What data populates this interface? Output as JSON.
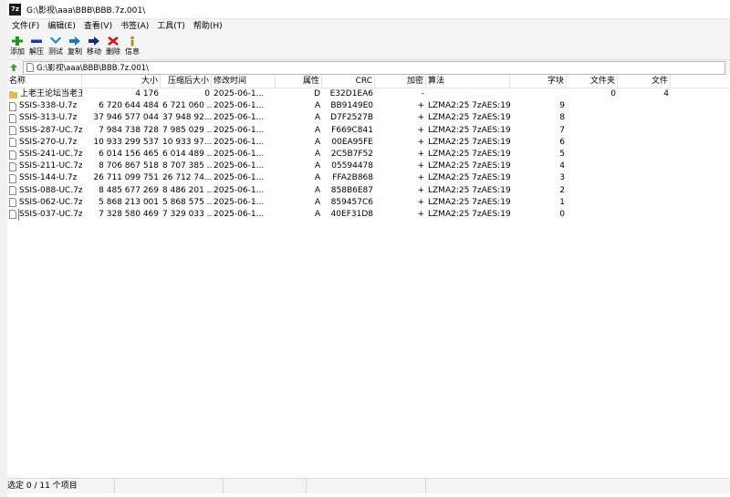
{
  "window": {
    "title": "G:\\影视\\aaa\\BBB\\BBB.7z.001\\",
    "app_icon_text": "7z"
  },
  "menu": [
    "文件(F)",
    "编辑(E)",
    "查看(V)",
    "书签(A)",
    "工具(T)",
    "帮助(H)"
  ],
  "toolbar": [
    {
      "label": "添加",
      "icon": "plus-icon",
      "color": "#1a9c1a"
    },
    {
      "label": "解压",
      "icon": "minus-icon",
      "color": "#1a3aa8"
    },
    {
      "label": "测试",
      "icon": "checkmark-icon",
      "color": "#1a8fb0"
    },
    {
      "label": "复制",
      "icon": "copy-arrow-icon",
      "color": "#1a5fb0"
    },
    {
      "label": "移动",
      "icon": "move-arrow-icon",
      "color": "#1a2a80"
    },
    {
      "label": "删除",
      "icon": "delete-x-icon",
      "color": "#d01818"
    },
    {
      "label": "信息",
      "icon": "info-icon",
      "color": "#b08a1a"
    }
  ],
  "address": {
    "path": "G:\\影视\\aaa\\BBB\\BBB.7z.001\\"
  },
  "columns": {
    "name": "名称",
    "size": "大小",
    "packed": "压缩后大小",
    "modified": "修改时间",
    "attributes": "属性",
    "crc": "CRC",
    "encrypted": "加密",
    "method": "算法",
    "block": "字块",
    "folders": "文件夹",
    "files": "文件"
  },
  "rows": [
    {
      "type": "folder",
      "name": "上老王论坛当老王",
      "size": "4 176",
      "packed": "0",
      "modified": "2025-06-1...",
      "attr": "D",
      "crc": "E32D1EA6",
      "enc": "-",
      "method": "",
      "block": "",
      "folders": "0",
      "files": "4"
    },
    {
      "type": "file",
      "name": "SSIS-338-U.7z",
      "size": "6 720 644 484",
      "packed": "6 721 060 ...",
      "modified": "2025-06-1...",
      "attr": "A",
      "crc": "BB9149E0",
      "enc": "+",
      "method": "LZMA2:25 7zAES:19",
      "block": "9",
      "folders": "",
      "files": ""
    },
    {
      "type": "file",
      "name": "SSIS-313-U.7z",
      "size": "37 946 577 044",
      "packed": "37 948 92...",
      "modified": "2025-06-1...",
      "attr": "A",
      "crc": "D7F2527B",
      "enc": "+",
      "method": "LZMA2:25 7zAES:19",
      "block": "8",
      "folders": "",
      "files": ""
    },
    {
      "type": "file",
      "name": "SSIS-287-UC.7z",
      "size": "7 984 738 728",
      "packed": "7 985 029 ...",
      "modified": "2025-06-1...",
      "attr": "A",
      "crc": "F669C841",
      "enc": "+",
      "method": "LZMA2:25 7zAES:19",
      "block": "7",
      "folders": "",
      "files": ""
    },
    {
      "type": "file",
      "name": "SSIS-270-U.7z",
      "size": "10 933 299 537",
      "packed": "10 933 97...",
      "modified": "2025-06-1...",
      "attr": "A",
      "crc": "00EA95FE",
      "enc": "+",
      "method": "LZMA2:25 7zAES:19",
      "block": "6",
      "folders": "",
      "files": ""
    },
    {
      "type": "file",
      "name": "SSIS-241-UC.7z",
      "size": "6 014 156 465",
      "packed": "6 014 489 ...",
      "modified": "2025-06-1...",
      "attr": "A",
      "crc": "2C5B7F52",
      "enc": "+",
      "method": "LZMA2:25 7zAES:19",
      "block": "5",
      "folders": "",
      "files": ""
    },
    {
      "type": "file",
      "name": "SSIS-211-UC.7z",
      "size": "8 706 867 518",
      "packed": "8 707 385 ...",
      "modified": "2025-06-1...",
      "attr": "A",
      "crc": "05594478",
      "enc": "+",
      "method": "LZMA2:25 7zAES:19",
      "block": "4",
      "folders": "",
      "files": ""
    },
    {
      "type": "file",
      "name": "SSIS-144-U.7z",
      "size": "26 711 099 751",
      "packed": "26 712 74...",
      "modified": "2025-06-1...",
      "attr": "A",
      "crc": "FFA2B868",
      "enc": "+",
      "method": "LZMA2:25 7zAES:19",
      "block": "3",
      "folders": "",
      "files": ""
    },
    {
      "type": "file",
      "name": "SSIS-088-UC.7z",
      "size": "8 485 677 269",
      "packed": "8 486 201 ...",
      "modified": "2025-06-1...",
      "attr": "A",
      "crc": "858B6E87",
      "enc": "+",
      "method": "LZMA2:25 7zAES:19",
      "block": "2",
      "folders": "",
      "files": ""
    },
    {
      "type": "file",
      "name": "SSIS-062-UC.7z",
      "size": "5 868 213 001",
      "packed": "5 868 575 ...",
      "modified": "2025-06-1...",
      "attr": "A",
      "crc": "859457C6",
      "enc": "+",
      "method": "LZMA2:25 7zAES:19",
      "block": "1",
      "folders": "",
      "files": ""
    },
    {
      "type": "file",
      "name": "SSIS-037-UC.7z",
      "size": "7 328 580 469",
      "packed": "7 329 033 ...",
      "modified": "2025-06-1...",
      "attr": "A",
      "crc": "40EF31D8",
      "enc": "+",
      "method": "LZMA2:25 7zAES:19",
      "block": "0",
      "folders": "",
      "files": "",
      "focused": true
    }
  ],
  "status": {
    "selection": "选定 0 / 11 个项目"
  },
  "colors": {
    "folder": "#e8b84a",
    "toolbar_bg": "#f4f4f4",
    "border": "#b8b8b8"
  }
}
